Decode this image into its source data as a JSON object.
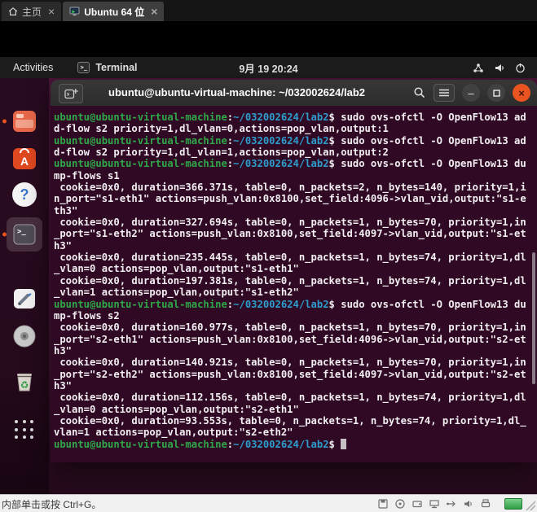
{
  "vmware": {
    "tabs": [
      {
        "label": "主页",
        "icon": "home"
      },
      {
        "label": "Ubuntu 64 位",
        "icon": "vm-monitor",
        "active": true
      }
    ],
    "statusbar": {
      "message": "内部单击或按 Ctrl+G。",
      "device_icons": [
        "floppy-disk",
        "cd-rom",
        "hard-disk",
        "network-adapter",
        "usb-device",
        "sound",
        "printer"
      ],
      "vm_state_color": "#2f9e44"
    }
  },
  "topbar": {
    "activities": "Activities",
    "app_name": "Terminal",
    "clock": "9月 19 20:24",
    "status_icons": [
      "network",
      "volume",
      "power"
    ]
  },
  "dock": {
    "items": [
      "files",
      "ubuntu-software",
      "help",
      "terminal",
      "text-editor",
      "disc",
      "trash",
      "app-grid"
    ],
    "active_item": "terminal",
    "running_items": [
      "files",
      "terminal"
    ]
  },
  "terminal": {
    "title": "ubuntu@ubuntu-virtual-machine: ~/032002624/lab2",
    "header_icons": [
      "new-tab",
      "search",
      "menu",
      "minimize",
      "maximize",
      "close"
    ],
    "prompt": {
      "user": "ubuntu@ubuntu-virtual-machine",
      "separator": ":",
      "path": "~/032002624/lab2",
      "suffix": "$ "
    },
    "colors": {
      "background": "#300a24",
      "prompt_user": "#2fa749",
      "prompt_path": "#2e9ccc",
      "text": "#f2eef2",
      "close_button": "#e95420"
    },
    "lines": [
      {
        "type": "cmd",
        "text": "sudo ovs-ofctl -O OpenFlow13 ad"
      },
      {
        "type": "out",
        "text": "d-flow s2 priority=1,dl_vlan=0,actions=pop_vlan,output:1"
      },
      {
        "type": "cmd",
        "text": "sudo ovs-ofctl -O OpenFlow13 ad"
      },
      {
        "type": "out",
        "text": "d-flow s2 priority=1,dl_vlan=1,actions=pop_vlan,output:2"
      },
      {
        "type": "cmd",
        "text": "sudo ovs-ofctl -O OpenFlow13 du"
      },
      {
        "type": "out",
        "text": "mp-flows s1"
      },
      {
        "type": "out",
        "text": " cookie=0x0, duration=366.371s, table=0, n_packets=2, n_bytes=140, priority=1,i"
      },
      {
        "type": "out",
        "text": "n_port=\"s1-eth1\" actions=push_vlan:0x8100,set_field:4096->vlan_vid,output:\"s1-e"
      },
      {
        "type": "out",
        "text": "th3\""
      },
      {
        "type": "out",
        "text": " cookie=0x0, duration=327.694s, table=0, n_packets=1, n_bytes=70, priority=1,in"
      },
      {
        "type": "out",
        "text": "_port=\"s1-eth2\" actions=push_vlan:0x8100,set_field:4097->vlan_vid,output:\"s1-et"
      },
      {
        "type": "out",
        "text": "h3\""
      },
      {
        "type": "out",
        "text": " cookie=0x0, duration=235.445s, table=0, n_packets=1, n_bytes=74, priority=1,dl"
      },
      {
        "type": "out",
        "text": "_vlan=0 actions=pop_vlan,output:\"s1-eth1\""
      },
      {
        "type": "out",
        "text": " cookie=0x0, duration=197.381s, table=0, n_packets=1, n_bytes=74, priority=1,dl"
      },
      {
        "type": "out",
        "text": "_vlan=1 actions=pop_vlan,output:\"s1-eth2\""
      },
      {
        "type": "cmd",
        "text": "sudo ovs-ofctl -O OpenFlow13 du"
      },
      {
        "type": "out",
        "text": "mp-flows s2"
      },
      {
        "type": "out",
        "text": " cookie=0x0, duration=160.977s, table=0, n_packets=1, n_bytes=70, priority=1,in"
      },
      {
        "type": "out",
        "text": "_port=\"s2-eth1\" actions=push_vlan:0x8100,set_field:4096->vlan_vid,output:\"s2-et"
      },
      {
        "type": "out",
        "text": "h3\""
      },
      {
        "type": "out",
        "text": " cookie=0x0, duration=140.921s, table=0, n_packets=1, n_bytes=70, priority=1,in"
      },
      {
        "type": "out",
        "text": "_port=\"s2-eth2\" actions=push_vlan:0x8100,set_field:4097->vlan_vid,output:\"s2-et"
      },
      {
        "type": "out",
        "text": "h3\""
      },
      {
        "type": "out",
        "text": " cookie=0x0, duration=112.156s, table=0, n_packets=1, n_bytes=74, priority=1,dl"
      },
      {
        "type": "out",
        "text": "_vlan=0 actions=pop_vlan,output:\"s2-eth1\""
      },
      {
        "type": "out",
        "text": " cookie=0x0, duration=93.553s, table=0, n_packets=1, n_bytes=74, priority=1,dl_"
      },
      {
        "type": "out",
        "text": "vlan=1 actions=pop_vlan,output:\"s2-eth2\""
      },
      {
        "type": "prompt",
        "cursor": true
      }
    ]
  }
}
